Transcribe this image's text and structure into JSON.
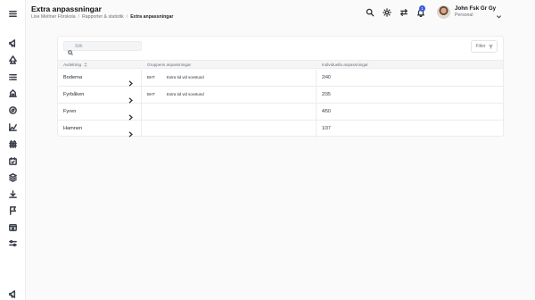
{
  "header": {
    "title": "Extra anpassningar",
    "breadcrumb": [
      "Lise Meitner Förskola",
      "Rapporter & statistik",
      "Extra anpassningar"
    ],
    "notification_count": "1",
    "user": {
      "name": "John Fsk Gr Gy",
      "role": "Personal"
    }
  },
  "sidebar": {
    "icons": [
      "menu-icon",
      "megaphone-icon",
      "tree-icon",
      "list-icon",
      "building-icon",
      "compass-icon",
      "graph-icon",
      "fence-icon",
      "calendar-check-icon",
      "layers-icon",
      "download-icon",
      "flag-icon",
      "store-icon",
      "sliders-icon",
      "megaphone-icon"
    ]
  },
  "toolbar": {
    "search_placeholder": "Sök",
    "filter_label": "Filter"
  },
  "table": {
    "columns": [
      "Avdelning",
      "Gruppens anpassningar",
      "Individuella anpassningar"
    ],
    "rows": [
      {
        "name": "Boderna",
        "tag": "BHT",
        "adaptation": "Extra tid vid sovstund",
        "individual": "2/40"
      },
      {
        "name": "Fyrbåken",
        "tag": "BHT",
        "adaptation": "Extra tid vid sovstund",
        "individual": "2/35"
      },
      {
        "name": "Fyren",
        "tag": "",
        "adaptation": "",
        "individual": "4/50"
      },
      {
        "name": "Hamnen",
        "tag": "",
        "adaptation": "",
        "individual": "1/37"
      }
    ]
  },
  "colors": {
    "accent": "#3b5bdb",
    "background": "#fafafa",
    "border": "#ececec"
  }
}
